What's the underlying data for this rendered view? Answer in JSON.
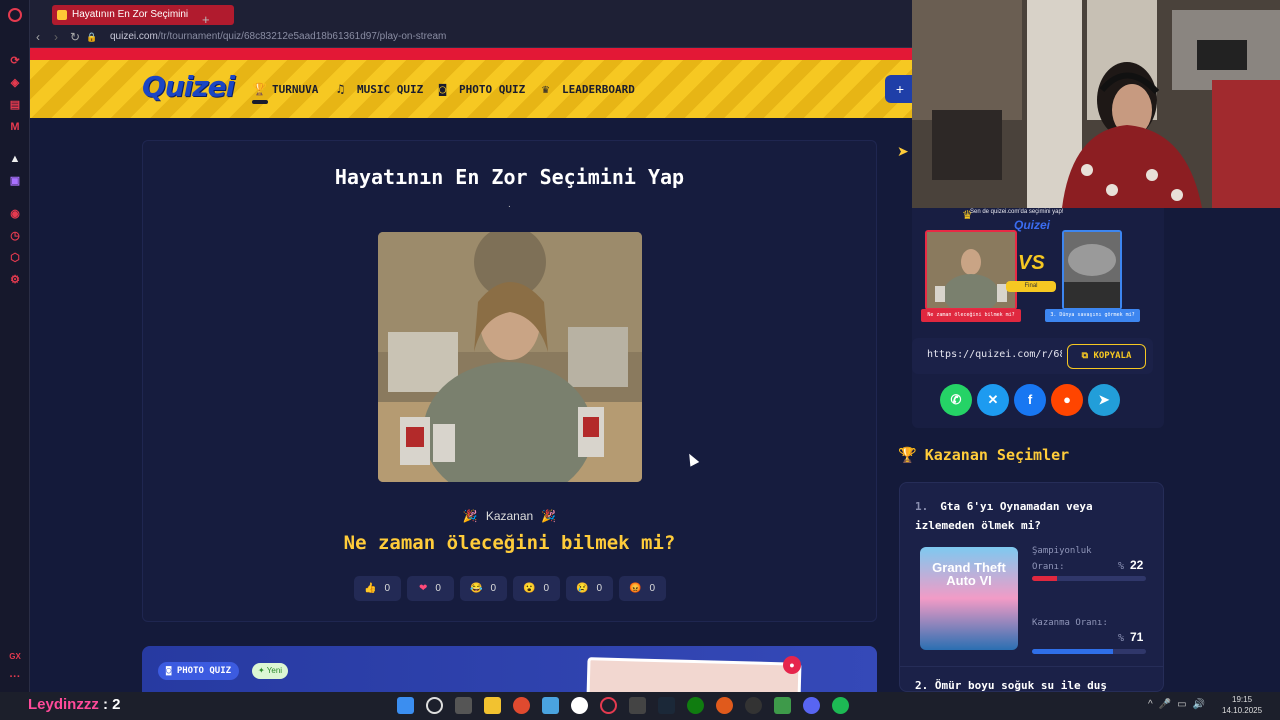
{
  "browser": {
    "tab_title": "Hayatının En Zor Seçimini",
    "tab_new": "+",
    "url_host": "quizei.com",
    "url_path": "/tr/tournament/quiz/68c83212e5aad18b61361d97/play-on-stream"
  },
  "site": {
    "logo": "Quizei",
    "nav": [
      {
        "label": "TURNUVA",
        "icon": "trophy-icon"
      },
      {
        "label": "MUSIC QUIZ",
        "icon": "music-note-icon"
      },
      {
        "label": "PHOTO QUIZ",
        "icon": "camera-icon"
      },
      {
        "label": "LEADERBOARD",
        "icon": "badge-icon"
      }
    ],
    "plus_label": "+"
  },
  "quiz": {
    "title": "Hayatının En Zor Seçimini Yap",
    "dot": ".",
    "winner_label": "Kazanan",
    "winner_choice": "Ne zaman öleceğini bilmek mi?",
    "reactions": [
      {
        "icon": "thumbs-up-icon",
        "glyph": "👍",
        "count": "0"
      },
      {
        "icon": "heart-icon",
        "glyph": "❤",
        "count": "0"
      },
      {
        "icon": "laugh-icon",
        "glyph": "😂",
        "count": "0"
      },
      {
        "icon": "wow-icon",
        "glyph": "😮",
        "count": "0"
      },
      {
        "icon": "sad-icon",
        "glyph": "😢",
        "count": "0"
      },
      {
        "icon": "angry-icon",
        "glyph": "😡",
        "count": "0"
      }
    ]
  },
  "photo_banner": {
    "badge": "PHOTO QUIZ",
    "new_badge": "Yeni"
  },
  "share": {
    "subtitle": "Sen de quizei.com'da seçimini yap!",
    "logo": "Quizei",
    "vs": "VS",
    "final_badge": "Final",
    "left_label": "Ne zaman öleceğini bilmek mi?",
    "right_label": "3. Dünya savaşını görmek mi?",
    "url": "https://quizei.com/r/68c",
    "copy_label": "KOPYALA",
    "socials": [
      {
        "icon": "whatsapp-icon",
        "glyph": "✆",
        "color": "#25d366"
      },
      {
        "icon": "x-icon",
        "glyph": "✕",
        "color": "#1d9bf0"
      },
      {
        "icon": "facebook-icon",
        "glyph": "f",
        "color": "#1877f2"
      },
      {
        "icon": "reddit-icon",
        "glyph": "●",
        "color": "#ff4500"
      },
      {
        "icon": "telegram-icon",
        "glyph": "➤",
        "color": "#229ed9"
      }
    ]
  },
  "winners": {
    "title": "Kazanan Seçimler",
    "items": [
      {
        "rank": "1.",
        "title": "Gta 6'yı Oynamadan veya izlemeden ölmek mi?",
        "image_text": "Grand Theft Auto VI",
        "champion_label": "Şampiyonluk Oranı:",
        "champion_pct_sign": "%",
        "champion_value": "22",
        "champion_fraction": 0.22,
        "win_label": "Kazanma Oranı:",
        "win_pct_sign": "%",
        "win_value": "71",
        "win_fraction": 0.71
      }
    ],
    "next_item": "2.   Ömür boyu soğuk su ile duş"
  },
  "taskbar": {
    "streamer_name": "Leydinzzz",
    "streamer_count": ": 2",
    "time": "19:15",
    "date": "14.10.2025"
  },
  "colors": {
    "accent_yellow": "#ffcc3a",
    "brand_blue": "#1b46c4",
    "red": "#e31836",
    "panel": "#161c3e"
  }
}
